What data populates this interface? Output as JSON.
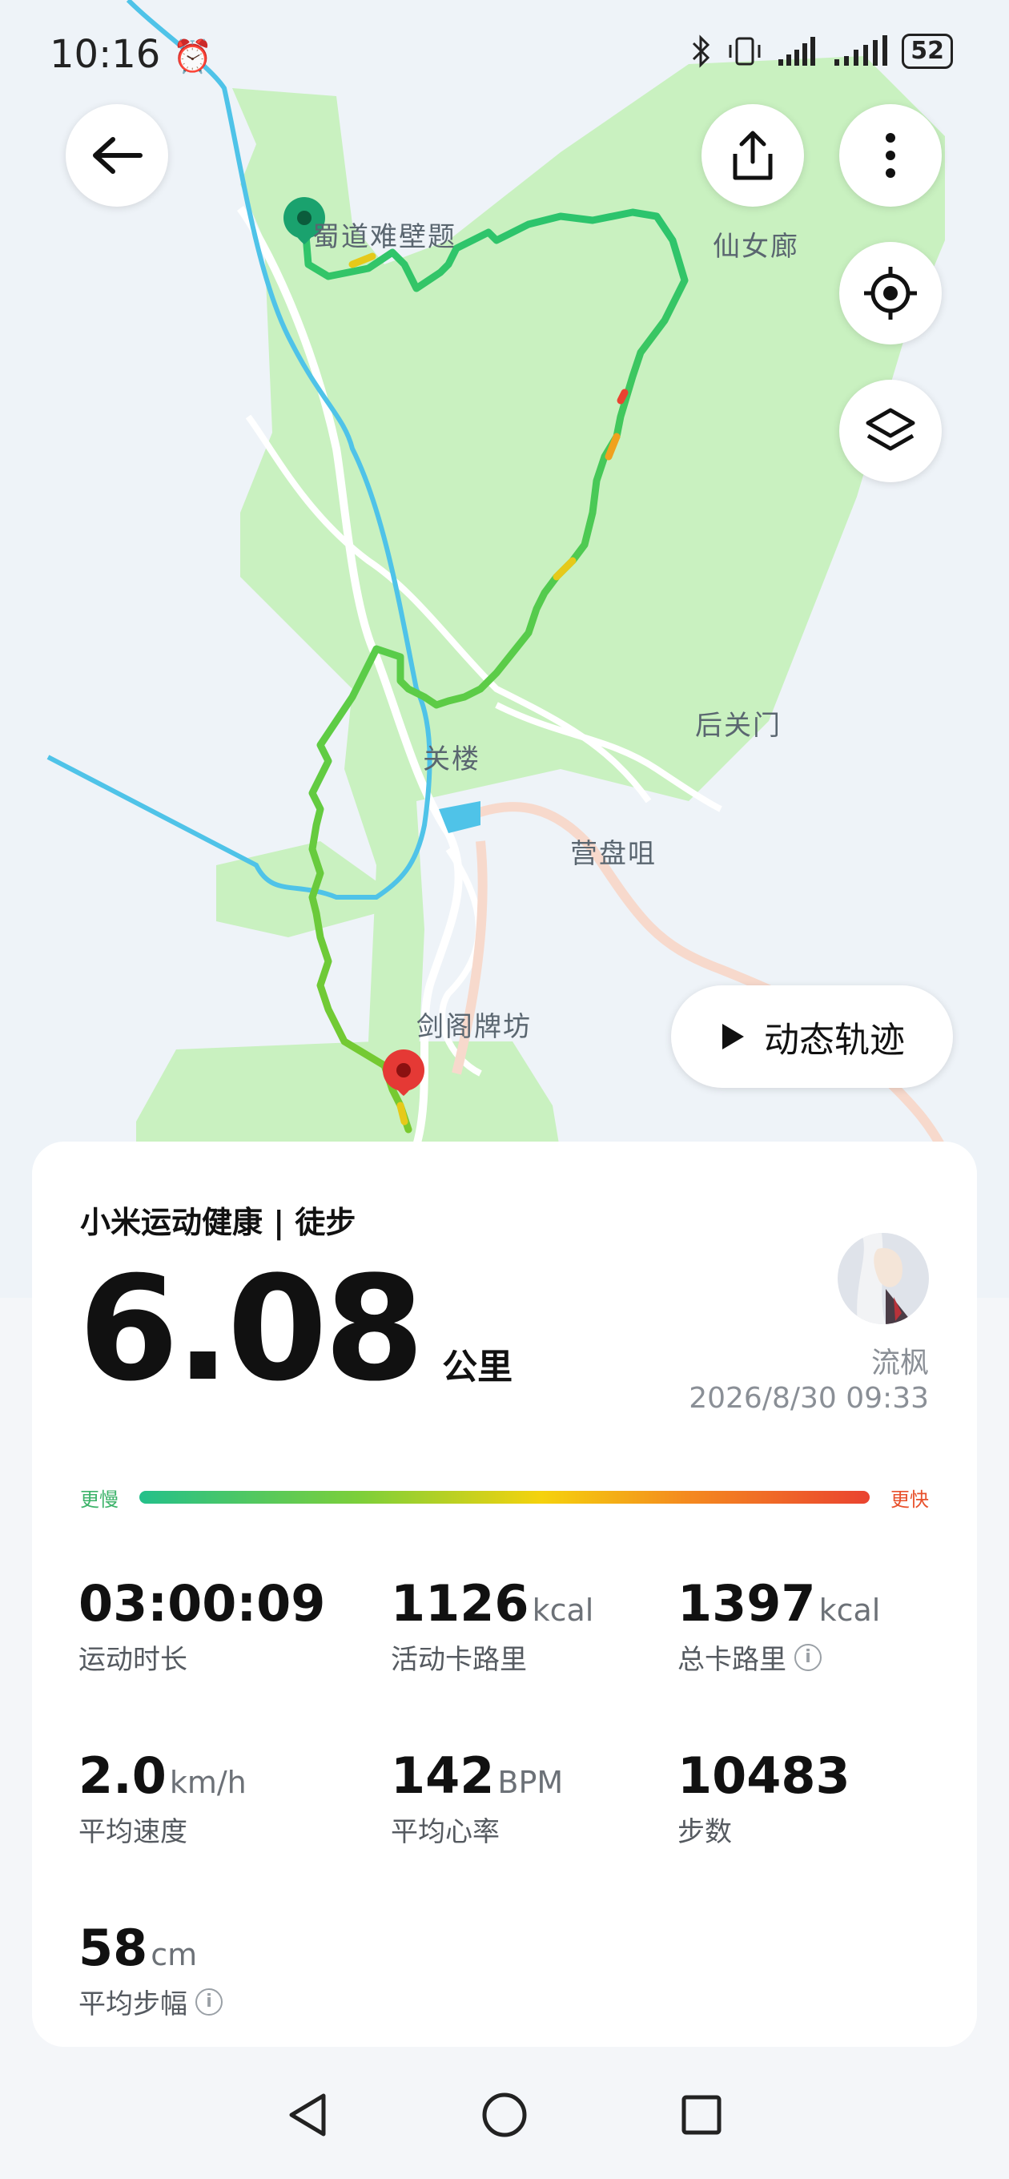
{
  "status_bar": {
    "time": "10:16",
    "battery": "52"
  },
  "map": {
    "labels": {
      "cliff_inscription": "蜀道难壁题",
      "fairy_corridor": "仙女廊",
      "back_gate": "后关门",
      "gate_tower": "关楼",
      "camp": "营盘咀",
      "archway": "剑阁牌坊"
    }
  },
  "toolbar": {
    "back_icon": "arrow-left-icon",
    "share_icon": "share-icon",
    "more_icon": "more-vertical-icon",
    "locate_icon": "target-icon",
    "layers_icon": "layers-icon"
  },
  "replay": {
    "label": "动态轨迹",
    "icon": "play-icon"
  },
  "summary": {
    "title": "小米运动健康 | 徒步",
    "distance": "6.08",
    "distance_unit": "公里",
    "user_name": "流枫",
    "date": "2026/8/30 09:33",
    "legend_slow": "更慢",
    "legend_fast": "更快",
    "stats": [
      {
        "value": "03:00:09",
        "unit": "",
        "label": "运动时长",
        "info": false
      },
      {
        "value": "1126",
        "unit": "kcal",
        "label": "活动卡路里",
        "info": false
      },
      {
        "value": "1397",
        "unit": "kcal",
        "label": "总卡路里",
        "info": true
      },
      {
        "value": "2.0",
        "unit": "km/h",
        "label": "平均速度",
        "info": false
      },
      {
        "value": "142",
        "unit": "BPM",
        "label": "平均心率",
        "info": false
      },
      {
        "value": "10483",
        "unit": "",
        "label": "步数",
        "info": false
      },
      {
        "value": "58",
        "unit": "cm",
        "label": "平均步幅",
        "info": true
      }
    ]
  },
  "colors": {
    "route_slow": "#24c08a",
    "route_fast": "#ea4330",
    "park_green": "#c9f1c0",
    "river": "#4fc3e8",
    "start_marker": "#1aa26e",
    "end_marker": "#e53935"
  },
  "nav_bar": {
    "back_icon": "triangle-back-icon",
    "home_icon": "circle-home-icon",
    "recents_icon": "square-recents-icon"
  }
}
